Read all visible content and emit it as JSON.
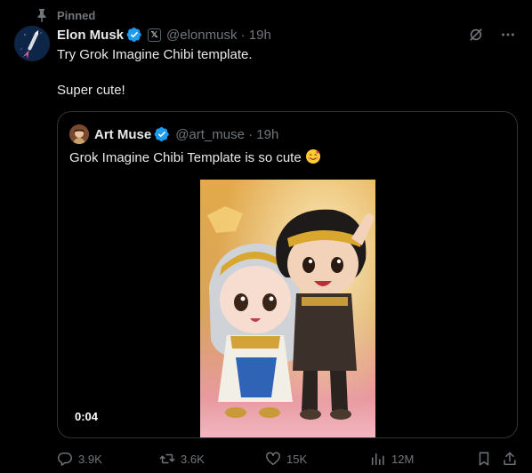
{
  "pinned": {
    "label": "Pinned",
    "icon": "pin-icon"
  },
  "tweet": {
    "display_name": "Elon Musk",
    "affiliate_badge": "𝕏",
    "handle_time": "@elonmusk · 19h",
    "text": "Try Grok Imagine Chibi template.\n\nSuper cute!"
  },
  "quote": {
    "display_name": "Art Muse",
    "handle_time": "@art_muse · 19h",
    "text": "Grok Imagine Chibi Template is so cute",
    "video_duration": "0:04"
  },
  "stats": {
    "replies": "3.9K",
    "reposts": "3.6K",
    "likes": "15K",
    "views": "12M"
  },
  "colors": {
    "background": "#000000",
    "text_primary": "#e7e9ea",
    "text_secondary": "#71767b",
    "border": "#2f3336",
    "verified": "#1d9bf0"
  }
}
